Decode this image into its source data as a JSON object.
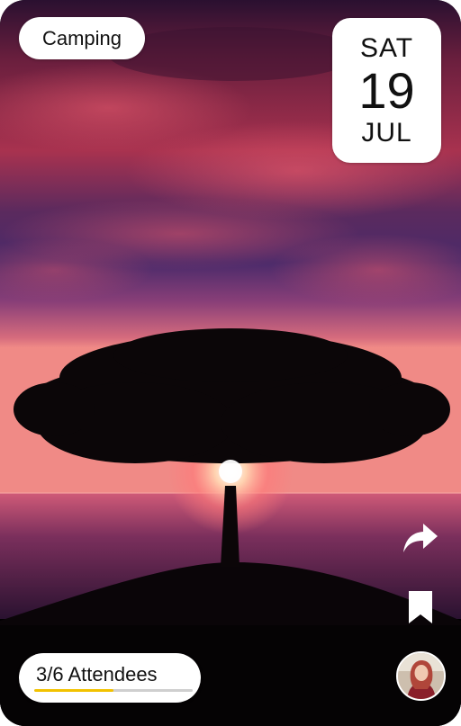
{
  "event": {
    "category": "Camping",
    "date": {
      "day": "SAT",
      "number": "19",
      "month": "JUL"
    },
    "attendees": {
      "label": "3/6 Attendees",
      "progress": 0.5
    }
  },
  "actions": {
    "share_icon": "share-arrow-icon",
    "bookmark_icon": "bookmark-icon"
  },
  "colors": {
    "chip_background": "#ffffff",
    "progress_fill": "#f2c200",
    "progress_track": "#cfcfcf"
  }
}
